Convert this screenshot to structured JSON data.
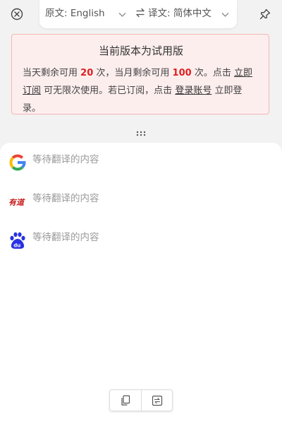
{
  "topbar": {
    "source_label": "原文: English",
    "target_label": "译文: 简体中文",
    "icons": [
      "close-icon",
      "chevron-down-icon",
      "swap-icon",
      "pin-icon"
    ]
  },
  "trial_notice": {
    "title": "当前版本为试用版",
    "text_1": "当天剩余可用",
    "daily_remaining": "20",
    "text_2": "次，当月剩余可用",
    "monthly_remaining": "100",
    "text_3": "次。点击",
    "subscribe_link": "立即订阅",
    "text_4": "可无限次使用。若已订阅，点击",
    "login_link": "登录账号",
    "text_5": "立即登录。",
    "colors": {
      "background": "#fdeeee",
      "border": "#f2b6b3",
      "highlight": "#e02020"
    }
  },
  "translations": [
    {
      "engine_icon": "google-logo-icon",
      "text": "等待翻译的内容"
    },
    {
      "engine_icon": "youdao-logo-icon",
      "text": "等待翻译的内容"
    },
    {
      "engine_icon": "baidu-logo-icon",
      "text": "等待翻译的内容"
    }
  ],
  "bottom_toolbar": {
    "icons": [
      "copy-icon",
      "replace-icon"
    ]
  }
}
